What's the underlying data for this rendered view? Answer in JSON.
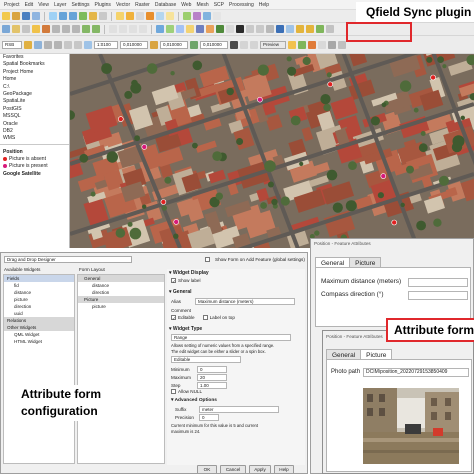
{
  "menu": [
    "Project",
    "Edit",
    "View",
    "Layer",
    "Settings",
    "Plugins",
    "Vector",
    "Raster",
    "Database",
    "Web",
    "Mesh",
    "SCP",
    "Processing",
    "Help"
  ],
  "toolbar": {
    "crs": "RSB",
    "scale": "1:0100",
    "value_a": "0,010000",
    "value_b": "0,010000",
    "value_c": "0,010000",
    "preview_label": "Preview"
  },
  "browser": {
    "items": [
      {
        "label": "Favorites",
        "bold": false
      },
      {
        "label": "Spatial Bookmarks",
        "bold": false
      },
      {
        "label": "Project Home",
        "bold": false
      },
      {
        "label": "Home",
        "bold": false
      },
      {
        "label": "C:\\",
        "bold": false
      },
      {
        "label": "GeoPackage",
        "bold": false
      },
      {
        "label": "SpatiaLite",
        "bold": false
      },
      {
        "label": "PostGIS",
        "bold": false
      },
      {
        "label": "MSSQL",
        "bold": false
      },
      {
        "label": "Oracle",
        "bold": false
      },
      {
        "label": "DB2",
        "bold": false
      },
      {
        "label": "WMS",
        "bold": false
      }
    ],
    "layers": {
      "position": "Position",
      "picture_absent": "Picture is absent",
      "picture_present": "Picture is present",
      "google": "Google Satellite"
    },
    "colors": {
      "absent": "#e02020",
      "present": "#d7197a"
    }
  },
  "callouts": {
    "qfield": "Qfield Sync plugin",
    "attribute_form": "Attribute form",
    "attribute_config_line1": "Attribute form",
    "attribute_config_line2": "configuration"
  },
  "designer": {
    "mode": "Drag and Drop Designer",
    "show_form_label": "Show Form on Add Feature (global settings)",
    "available_widgets_label": "Available Widgets",
    "form_layout_label": "Form Layout",
    "available_tree": [
      {
        "label": "Fields",
        "style": "sel"
      },
      {
        "label": "fid",
        "style": ""
      },
      {
        "label": "distance",
        "style": ""
      },
      {
        "label": "picture",
        "style": ""
      },
      {
        "label": "direction",
        "style": ""
      },
      {
        "label": "uuid",
        "style": ""
      },
      {
        "label": "Relations",
        "style": "grey"
      },
      {
        "label": "Other Widgets",
        "style": "grey"
      },
      {
        "label": "QML Widget",
        "style": ""
      },
      {
        "label": "HTML Widget",
        "style": ""
      }
    ],
    "form_tree": [
      {
        "label": "General",
        "style": "grey"
      },
      {
        "label": "distance",
        "style": ""
      },
      {
        "label": "direction",
        "style": ""
      },
      {
        "label": "Picture",
        "style": "grey"
      },
      {
        "label": "picture",
        "style": ""
      }
    ],
    "widget_display": {
      "title": "Widget Display",
      "show_label": "Show label"
    },
    "general": {
      "title": "General",
      "alias_label": "Alias",
      "alias_value": "Maximum distance (meters)",
      "comment_label": "Comment",
      "editable": "Editable",
      "label_on_top": "Label on top"
    },
    "widget_type": {
      "title": "Widget Type",
      "value": "Range",
      "desc1": "Allows setting of numeric values from a specified range.",
      "desc2": "The edit widget can be either a slider or a spin box.",
      "editable": "Editable",
      "min_label": "Minimum",
      "min_value": "0",
      "max_label": "Maximum",
      "max_value": "20",
      "step_label": "Step",
      "step_value": "1.00",
      "allow_null": "Allow NULL",
      "advanced": "Advanced Options",
      "suffix_label": "Suffix",
      "suffix_value": "meter",
      "precision_label": "Precision",
      "precision_value": "0",
      "current_min": "Current minimum for this value is 5 and current",
      "current_max": "maximum is 24."
    },
    "buttons": {
      "ok": "OK",
      "cancel": "Cancel",
      "apply": "Apply",
      "help": "Help"
    }
  },
  "feature_general": {
    "title": "Position - Feature Attributes",
    "tabs": [
      "General",
      "Picture"
    ],
    "active_tab": 0,
    "max_distance_label": "Maximum distance (meters)",
    "compass_label": "Compass direction (°)"
  },
  "feature_picture": {
    "title": "Position - Feature Attributes",
    "tabs": [
      "General",
      "Picture"
    ],
    "active_tab": 1,
    "photo_label": "Photo path",
    "photo_value": "DCIM\\position_20220729153850409"
  }
}
